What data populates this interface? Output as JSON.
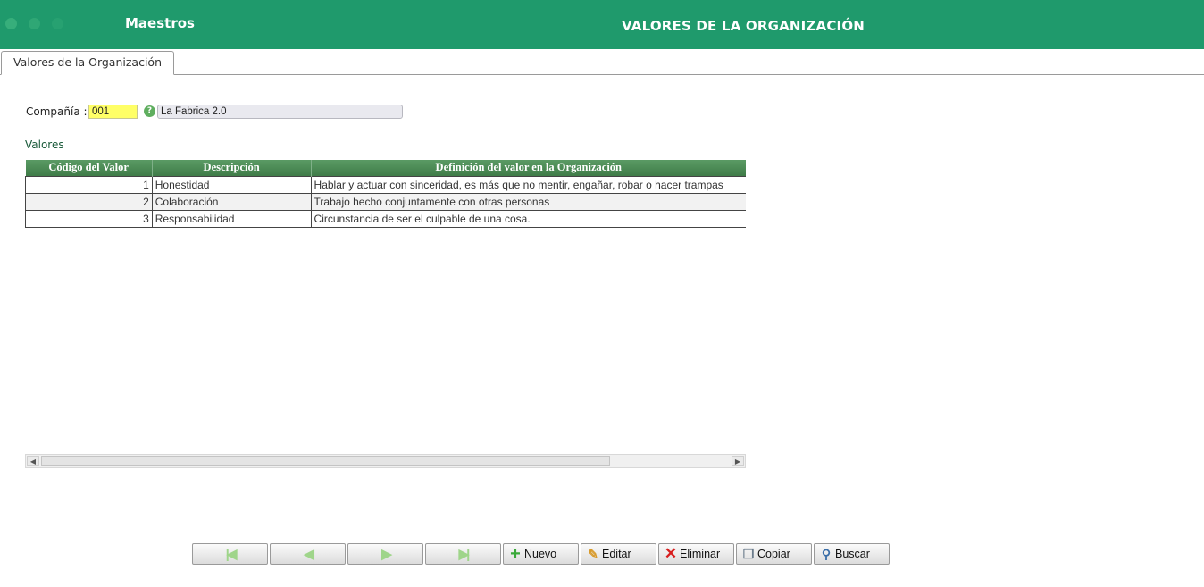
{
  "header": {
    "module": "Maestros",
    "title": "VALORES DE LA ORGANIZACIÓN"
  },
  "tabs": [
    {
      "label": "Valores de la Organización",
      "active": true
    }
  ],
  "company": {
    "label": "Compañía :",
    "code": "001",
    "name": "La Fabrica 2.0"
  },
  "section": {
    "label": "Valores"
  },
  "table": {
    "columns": [
      "Código del Valor",
      "Descripción",
      "Definición del valor en la Organización"
    ],
    "rows": [
      {
        "code": "1",
        "description": "Honestidad",
        "definition": "Hablar y actuar con sinceridad, es más que no mentir, engañar, robar o hacer trampas"
      },
      {
        "code": "2",
        "description": "Colaboración",
        "definition": "Trabajo hecho conjuntamente con otras personas"
      },
      {
        "code": "3",
        "description": "Responsabilidad",
        "definition": "Circunstancia de ser el culpable de una cosa."
      }
    ]
  },
  "toolbar": {
    "first_icon": "first-record-icon",
    "prev_icon": "previous-record-icon",
    "next_icon": "next-record-icon",
    "last_icon": "last-record-icon",
    "new_label": "Nuevo",
    "edit_label": "Editar",
    "delete_label": "Eliminar",
    "copy_label": "Copiar",
    "search_label": "Buscar"
  },
  "colors": {
    "header_bg": "#1f9a6c",
    "grid_header_bg": "#4a8a54",
    "code_field_bg": "#ffff66"
  }
}
